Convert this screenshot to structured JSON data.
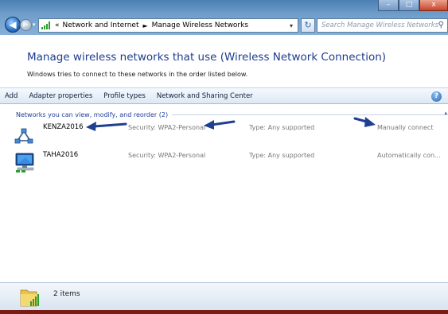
{
  "address": {
    "crumb_prefix": "«",
    "segments": [
      "Network and Internet",
      "Manage Wireless Networks"
    ],
    "separator": "►",
    "dropdown": "▾"
  },
  "search": {
    "placeholder": "Search Manage Wireless Networks",
    "icon": "search-icon"
  },
  "header": {
    "title": "Manage wireless networks that use (Wireless Network Connection)",
    "subtitle": "Windows tries to connect to these networks in the order listed below."
  },
  "toolbar": {
    "items": [
      "Add",
      "Adapter properties",
      "Profile types",
      "Network and Sharing Center"
    ],
    "help_label": "?"
  },
  "group": {
    "label": "Networks you can view, modify, and reorder (2)"
  },
  "networks": [
    {
      "name": "KENZA2016",
      "security": "Security: WPA2-Personal",
      "type": "Type: Any supported",
      "mode": "Manually connect"
    },
    {
      "name": "TAHA2016",
      "security": "Security: WPA2-Personal",
      "type": "Type: Any supported",
      "mode": "Automatically con..."
    }
  ],
  "status": {
    "count": "2 items"
  },
  "colors": {
    "title_blue": "#1e3d8f",
    "link_blue": "#1e3fa0",
    "annotation_arrow": "#1f3f8f",
    "frame": "#7a1c14"
  }
}
